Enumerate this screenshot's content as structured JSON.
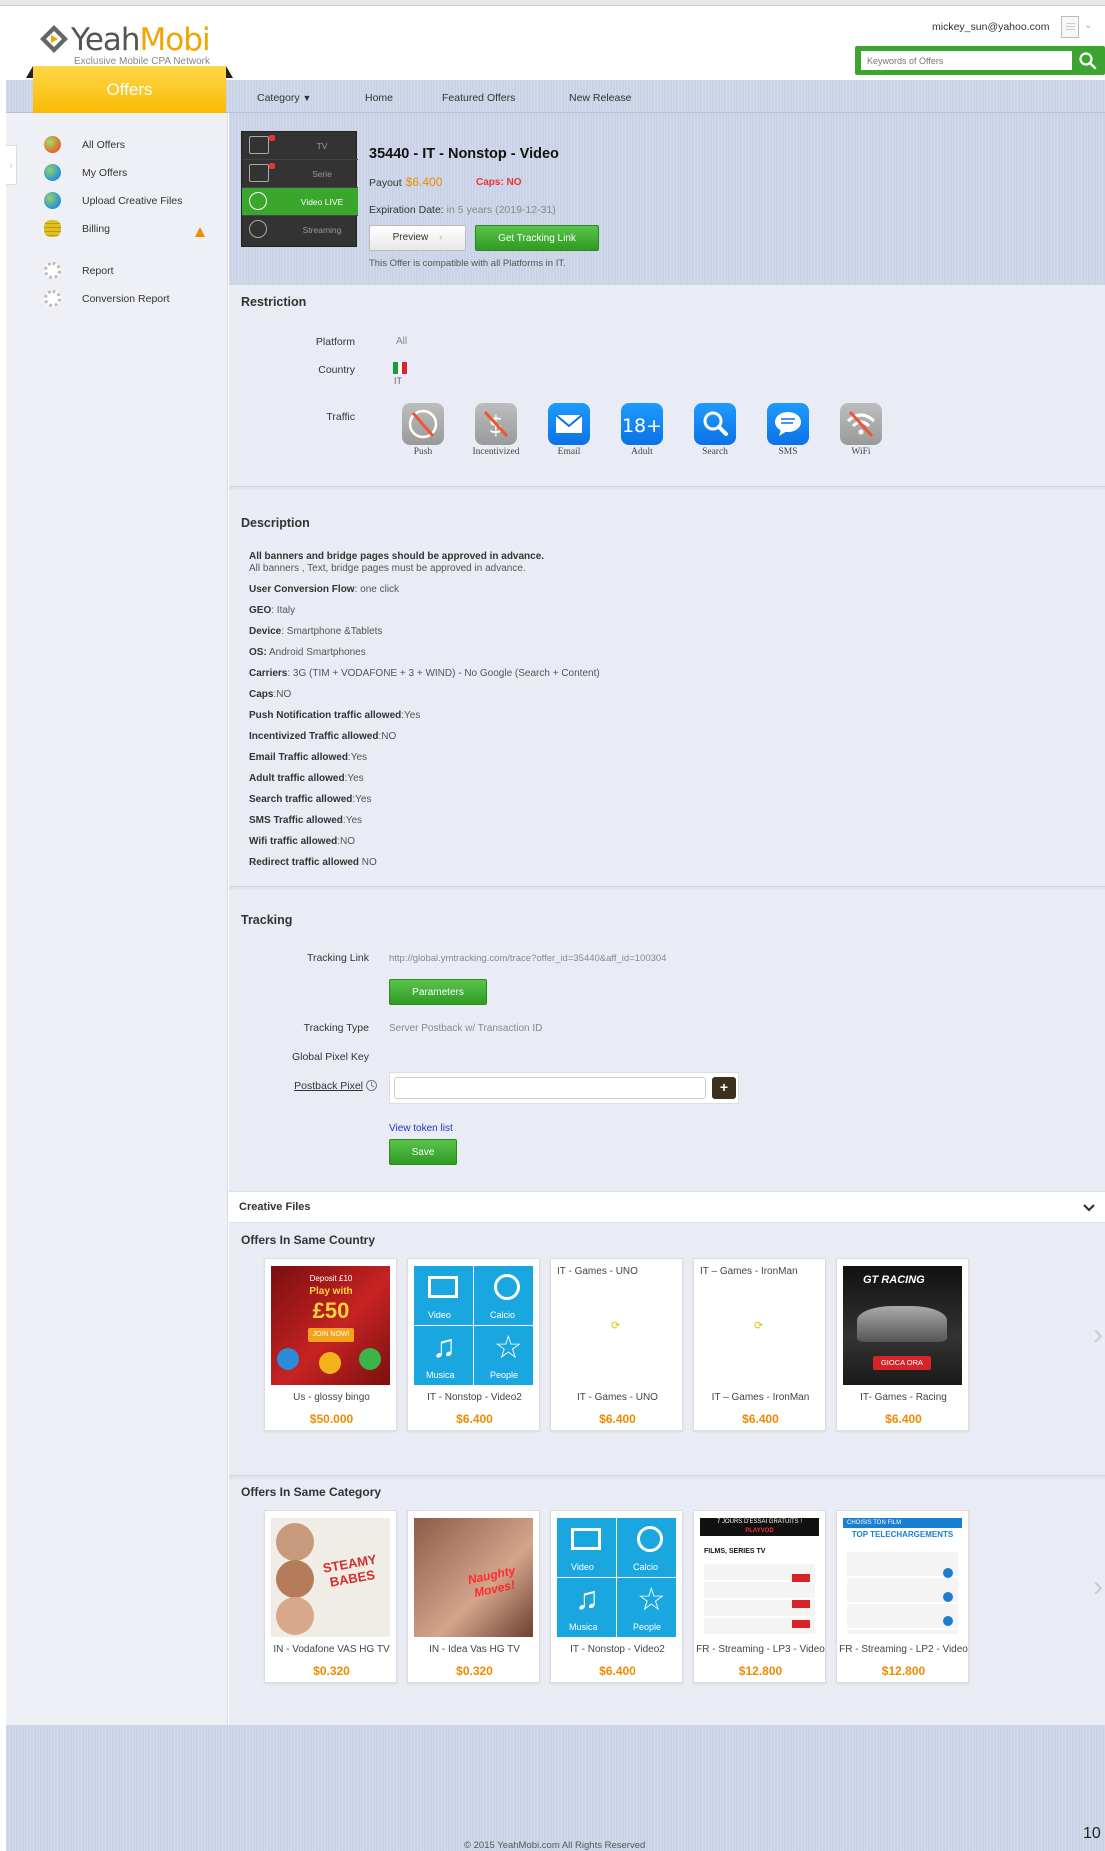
{
  "brand": {
    "name_a": "Yeah",
    "name_b": "Mobi",
    "tagline": "Exclusive Mobile CPA Network"
  },
  "user": {
    "email": "mickey_sun@yahoo.com"
  },
  "search": {
    "placeholder": "Keywords of Offers"
  },
  "nav": {
    "offers_tab": "Offers",
    "items": [
      "Category",
      "Home",
      "Featured Offers",
      "New Release"
    ]
  },
  "sidebar": {
    "items": [
      {
        "label": "All Offers",
        "color": "#e8632a"
      },
      {
        "label": "My Offers",
        "color": "#2b8fd6"
      },
      {
        "label": "Upload Creative Files",
        "color": "#2b8fd6"
      },
      {
        "label": "Billing",
        "color": "#e0c020"
      },
      {
        "label": "Report",
        "color": "#bbbbbb"
      },
      {
        "label": "Conversion Report",
        "color": "#bbbbbb"
      }
    ]
  },
  "offer": {
    "menu": [
      "TV",
      "Serie",
      "Video LIVE",
      "Streaming"
    ],
    "title": "35440 - IT - Nonstop - Video",
    "payout_label": "Payout",
    "payout_value": "$6.400",
    "caps": "Caps: NO",
    "expiry_label": "Expiration Date:",
    "expiry_value": "in 5 years (2019-12-31)",
    "preview_btn": "Preview",
    "tracking_btn": "Get Tracking Link",
    "compat": "This Offer is compatible with all Platforms in IT."
  },
  "restriction": {
    "title": "Restriction",
    "platform_label": "Platform",
    "platform_value": "All",
    "country_label": "Country",
    "country_value": "IT",
    "traffic_label": "Traffic",
    "traffic": [
      {
        "label": "Push",
        "state": "disallowed"
      },
      {
        "label": "Incentivized",
        "state": "disallowed"
      },
      {
        "label": "Email",
        "state": "allowed"
      },
      {
        "label": "Adult",
        "state": "allowed"
      },
      {
        "label": "Search",
        "state": "allowed"
      },
      {
        "label": "SMS",
        "state": "allowed"
      },
      {
        "label": "WiFi",
        "state": "disallowed"
      }
    ]
  },
  "description": {
    "title": "Description",
    "lines": [
      {
        "k": "All banners and bridge pages should be approved in advance.",
        "v": ""
      },
      {
        "k": "",
        "v": "All banners , Text, bridge pages must be approved in advance."
      },
      {
        "k": "User Conversion Flow",
        "v": ": one click"
      },
      {
        "k": "GEO",
        "v": ": Italy"
      },
      {
        "k": "Device",
        "v": ": Smartphone &Tablets"
      },
      {
        "k": "OS:",
        "v": " Android Smartphones"
      },
      {
        "k": "Carriers",
        "v": ": 3G (TIM + VODAFONE + 3 + WIND) - No Google (Search + Content)"
      },
      {
        "k": "Caps",
        "v": ":NO"
      },
      {
        "k": "Push Notification traffic allowed",
        "v": ":Yes"
      },
      {
        "k": "Incentivized Traffic allowed",
        "v": ":NO"
      },
      {
        "k": "Email Traffic allowed",
        "v": ":Yes"
      },
      {
        "k": "Adult traffic allowed",
        "v": ":Yes"
      },
      {
        "k": "Search traffic allowed",
        "v": ":Yes"
      },
      {
        "k": "SMS Traffic allowed",
        "v": ":Yes"
      },
      {
        "k": "Wifi traffic allowed",
        "v": ":NO"
      },
      {
        "k": "Redirect traffic allowed",
        "v": " NO"
      }
    ]
  },
  "tracking": {
    "title": "Tracking",
    "link_label": "Tracking Link",
    "link_value": "http://global.ymtracking.com/trace?offer_id=35440&aff_id=100304",
    "params_btn": "Parameters",
    "type_label": "Tracking Type",
    "type_value": "Server Postback w/ Transaction ID",
    "pixel_key_label": "Global Pixel Key",
    "postback_label": "Postback Pixel",
    "postback_value": "",
    "token_link": "View token list",
    "save_btn": "Save"
  },
  "creative": {
    "title": "Creative Files"
  },
  "same_country": {
    "title": "Offers In Same Country",
    "cards": [
      {
        "name": "Us - glossy bingo",
        "price": "$50.000",
        "top": ""
      },
      {
        "name": "IT - Nonstop - Video2",
        "price": "$6.400",
        "top": ""
      },
      {
        "name": "IT - Games - UNO",
        "price": "$6.400",
        "top": "IT - Games - UNO"
      },
      {
        "name": "IT – Games - IronMan",
        "price": "$6.400",
        "top": "IT – Games - IronMan"
      },
      {
        "name": "IT- Games - Racing",
        "price": "$6.400",
        "top": ""
      }
    ]
  },
  "same_category": {
    "title": "Offers In Same Category",
    "cards": [
      {
        "name": "IN - Vodafone VAS HG TV",
        "price": "$0.320"
      },
      {
        "name": "IN - Idea Vas HG TV",
        "price": "$0.320"
      },
      {
        "name": "IT - Nonstop - Video2",
        "price": "$6.400"
      },
      {
        "name": "FR - Streaming - LP3 - Video",
        "price": "$12.800"
      },
      {
        "name": "FR - Streaming - LP2 - Video",
        "price": "$12.800"
      }
    ]
  },
  "thumb_text": {
    "bingo": [
      "Deposit £10",
      "Play with",
      "£50",
      "JOIN NOW!"
    ],
    "video_tiles": [
      "Video",
      "Calcio",
      "Musica",
      "People"
    ],
    "racing": [
      "GT RACING",
      "GIOCA ORA"
    ],
    "steamy": "STEAMY BABES",
    "naughty": "Naughty Moves!",
    "playvod": [
      "7 JOURS D'ESSAI GRATUITS !",
      "PLAYVOD",
      "FILMS, SERIES TV"
    ],
    "topdl": [
      "CHOISIS TON FILM",
      "TOP TELECHARGEMENTS"
    ]
  },
  "footer": {
    "copyright": "© 2015 YeahMobi.com All Rights Reserved",
    "edge": "10"
  },
  "colors": {
    "accent_green": "#3ca52f",
    "accent_orange": "#f08a00",
    "offers_yellow": "#f8b900"
  }
}
